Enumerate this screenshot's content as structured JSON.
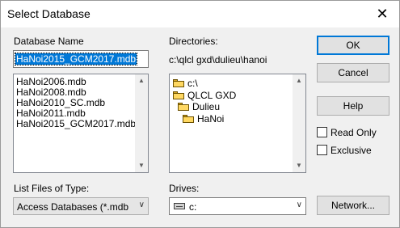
{
  "window": {
    "title": "Select Database",
    "close_glyph": "✕"
  },
  "database_name": {
    "label": "Database Name",
    "value": "HaNoi2015_GCM2017.mdb",
    "files": [
      "HaNoi2006.mdb",
      "HaNoi2008.mdb",
      "HaNoi2010_SC.mdb",
      "HaNoi2011.mdb",
      "HaNoi2015_GCM2017.mdb"
    ]
  },
  "directories": {
    "label": "Directories:",
    "current_path": "c:\\qlcl gxd\\dulieu\\hanoi",
    "tree": [
      "c:\\",
      "QLCL GXD",
      "Dulieu",
      "HaNoi"
    ]
  },
  "file_type": {
    "label": "List Files of Type:",
    "value": "Access Databases (*.mdb"
  },
  "drives": {
    "label": "Drives:",
    "value": "c:"
  },
  "buttons": {
    "ok": "OK",
    "cancel": "Cancel",
    "help": "Help",
    "network": "Network..."
  },
  "options": {
    "read_only": "Read Only",
    "exclusive": "Exclusive"
  },
  "scroll_up": "▲",
  "scroll_down": "▼",
  "dropdown_arrow": "∨",
  "icons": {
    "folder": "folder-icon",
    "open_folder": "open-folder-icon",
    "drive": "drive-icon"
  }
}
